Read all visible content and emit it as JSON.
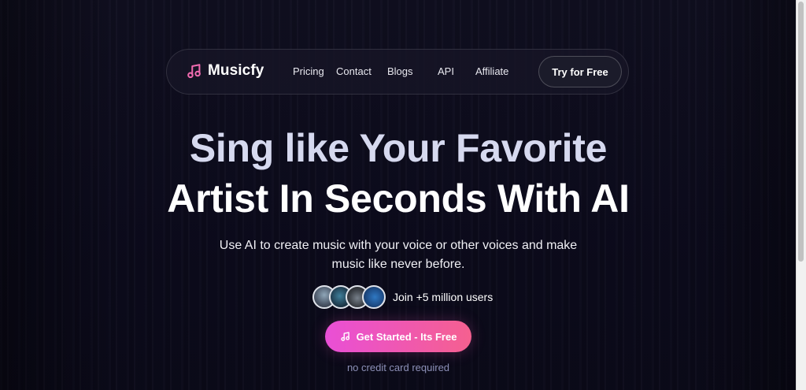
{
  "nav": {
    "brand": "Musicfy",
    "links": [
      {
        "label": "Pricing"
      },
      {
        "label": "Contact"
      },
      {
        "label": "Blogs"
      },
      {
        "label": "API"
      },
      {
        "label": "Affiliate"
      }
    ],
    "cta": "Try for Free"
  },
  "hero": {
    "title_line1": "Sing like Your Favorite",
    "title_line2": "Artist In Seconds With AI",
    "subtitle": "Use AI to create music with your voice or other voices and make music like never before.",
    "users_text": "Join +5 million users",
    "cta": "Get Started - Its Free",
    "cta_note": "no credit card required"
  },
  "icons": {
    "logo": "music-note-icon",
    "cta": "music-note-icon"
  },
  "colors": {
    "background": "#0c0b1b",
    "accent_gradient_start": "#e94fd6",
    "accent_gradient_end": "#f5608f",
    "logo_note": "#f06bb0"
  }
}
